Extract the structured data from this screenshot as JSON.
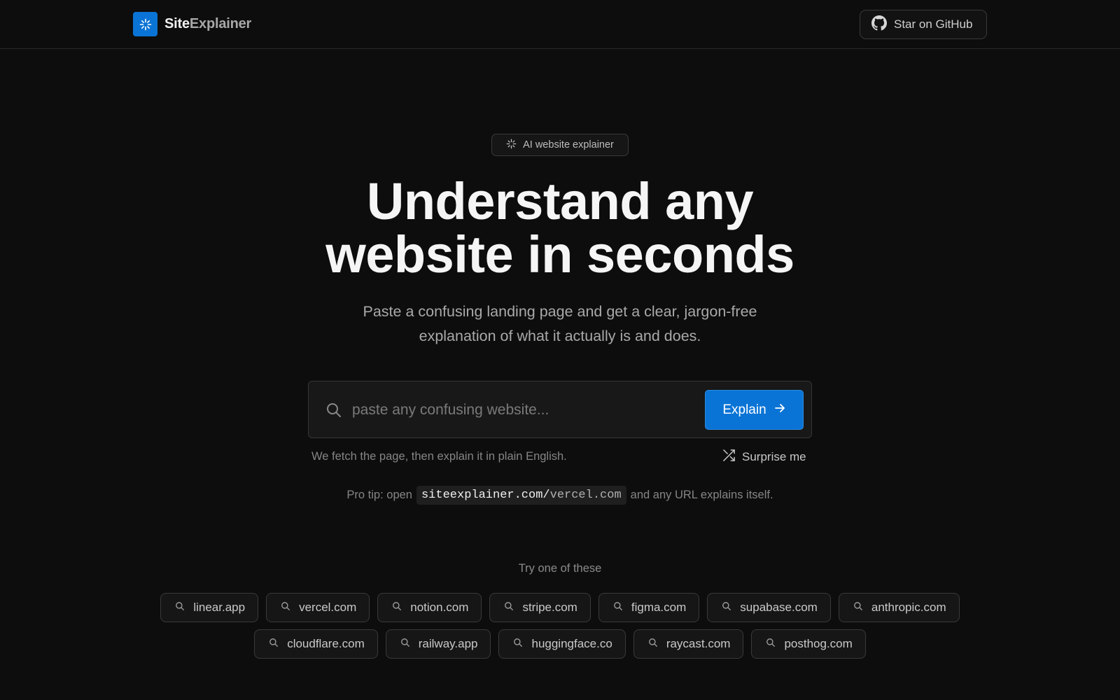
{
  "header": {
    "brand_site": "Site",
    "brand_explainer": "Explainer",
    "github_label": "Star on GitHub"
  },
  "hero": {
    "badge": "AI website explainer",
    "headline_line1": "Understand any",
    "headline_line2": "website in seconds",
    "subhead_line1": "Paste a confusing landing page and get a clear, jargon-free",
    "subhead_line2": "explanation of what it actually is and does."
  },
  "search": {
    "placeholder": "paste any confusing website...",
    "button_label": "Explain",
    "hint": "We fetch the page, then explain it in plain English.",
    "surprise_label": "Surprise me"
  },
  "protip": {
    "prefix": "Pro tip: open",
    "code_domain": "siteexplainer.com/",
    "code_path": "vercel.com",
    "suffix": "and any URL explains itself."
  },
  "suggestions": {
    "label": "Try one of these",
    "row1": [
      "linear.app",
      "vercel.com",
      "notion.com",
      "stripe.com",
      "figma.com",
      "supabase.com",
      "anthropic.com"
    ],
    "row2": [
      "cloudflare.com",
      "railway.app",
      "huggingface.co",
      "raycast.com",
      "posthog.com"
    ]
  },
  "colors": {
    "background": "#0d0d0d",
    "accent": "#0a74d6",
    "border": "#3a3a3a"
  },
  "icons": {
    "brand": "sparkle-icon",
    "github": "github-icon",
    "search": "search-icon",
    "arrow": "arrow-right-icon",
    "shuffle": "shuffle-icon"
  }
}
